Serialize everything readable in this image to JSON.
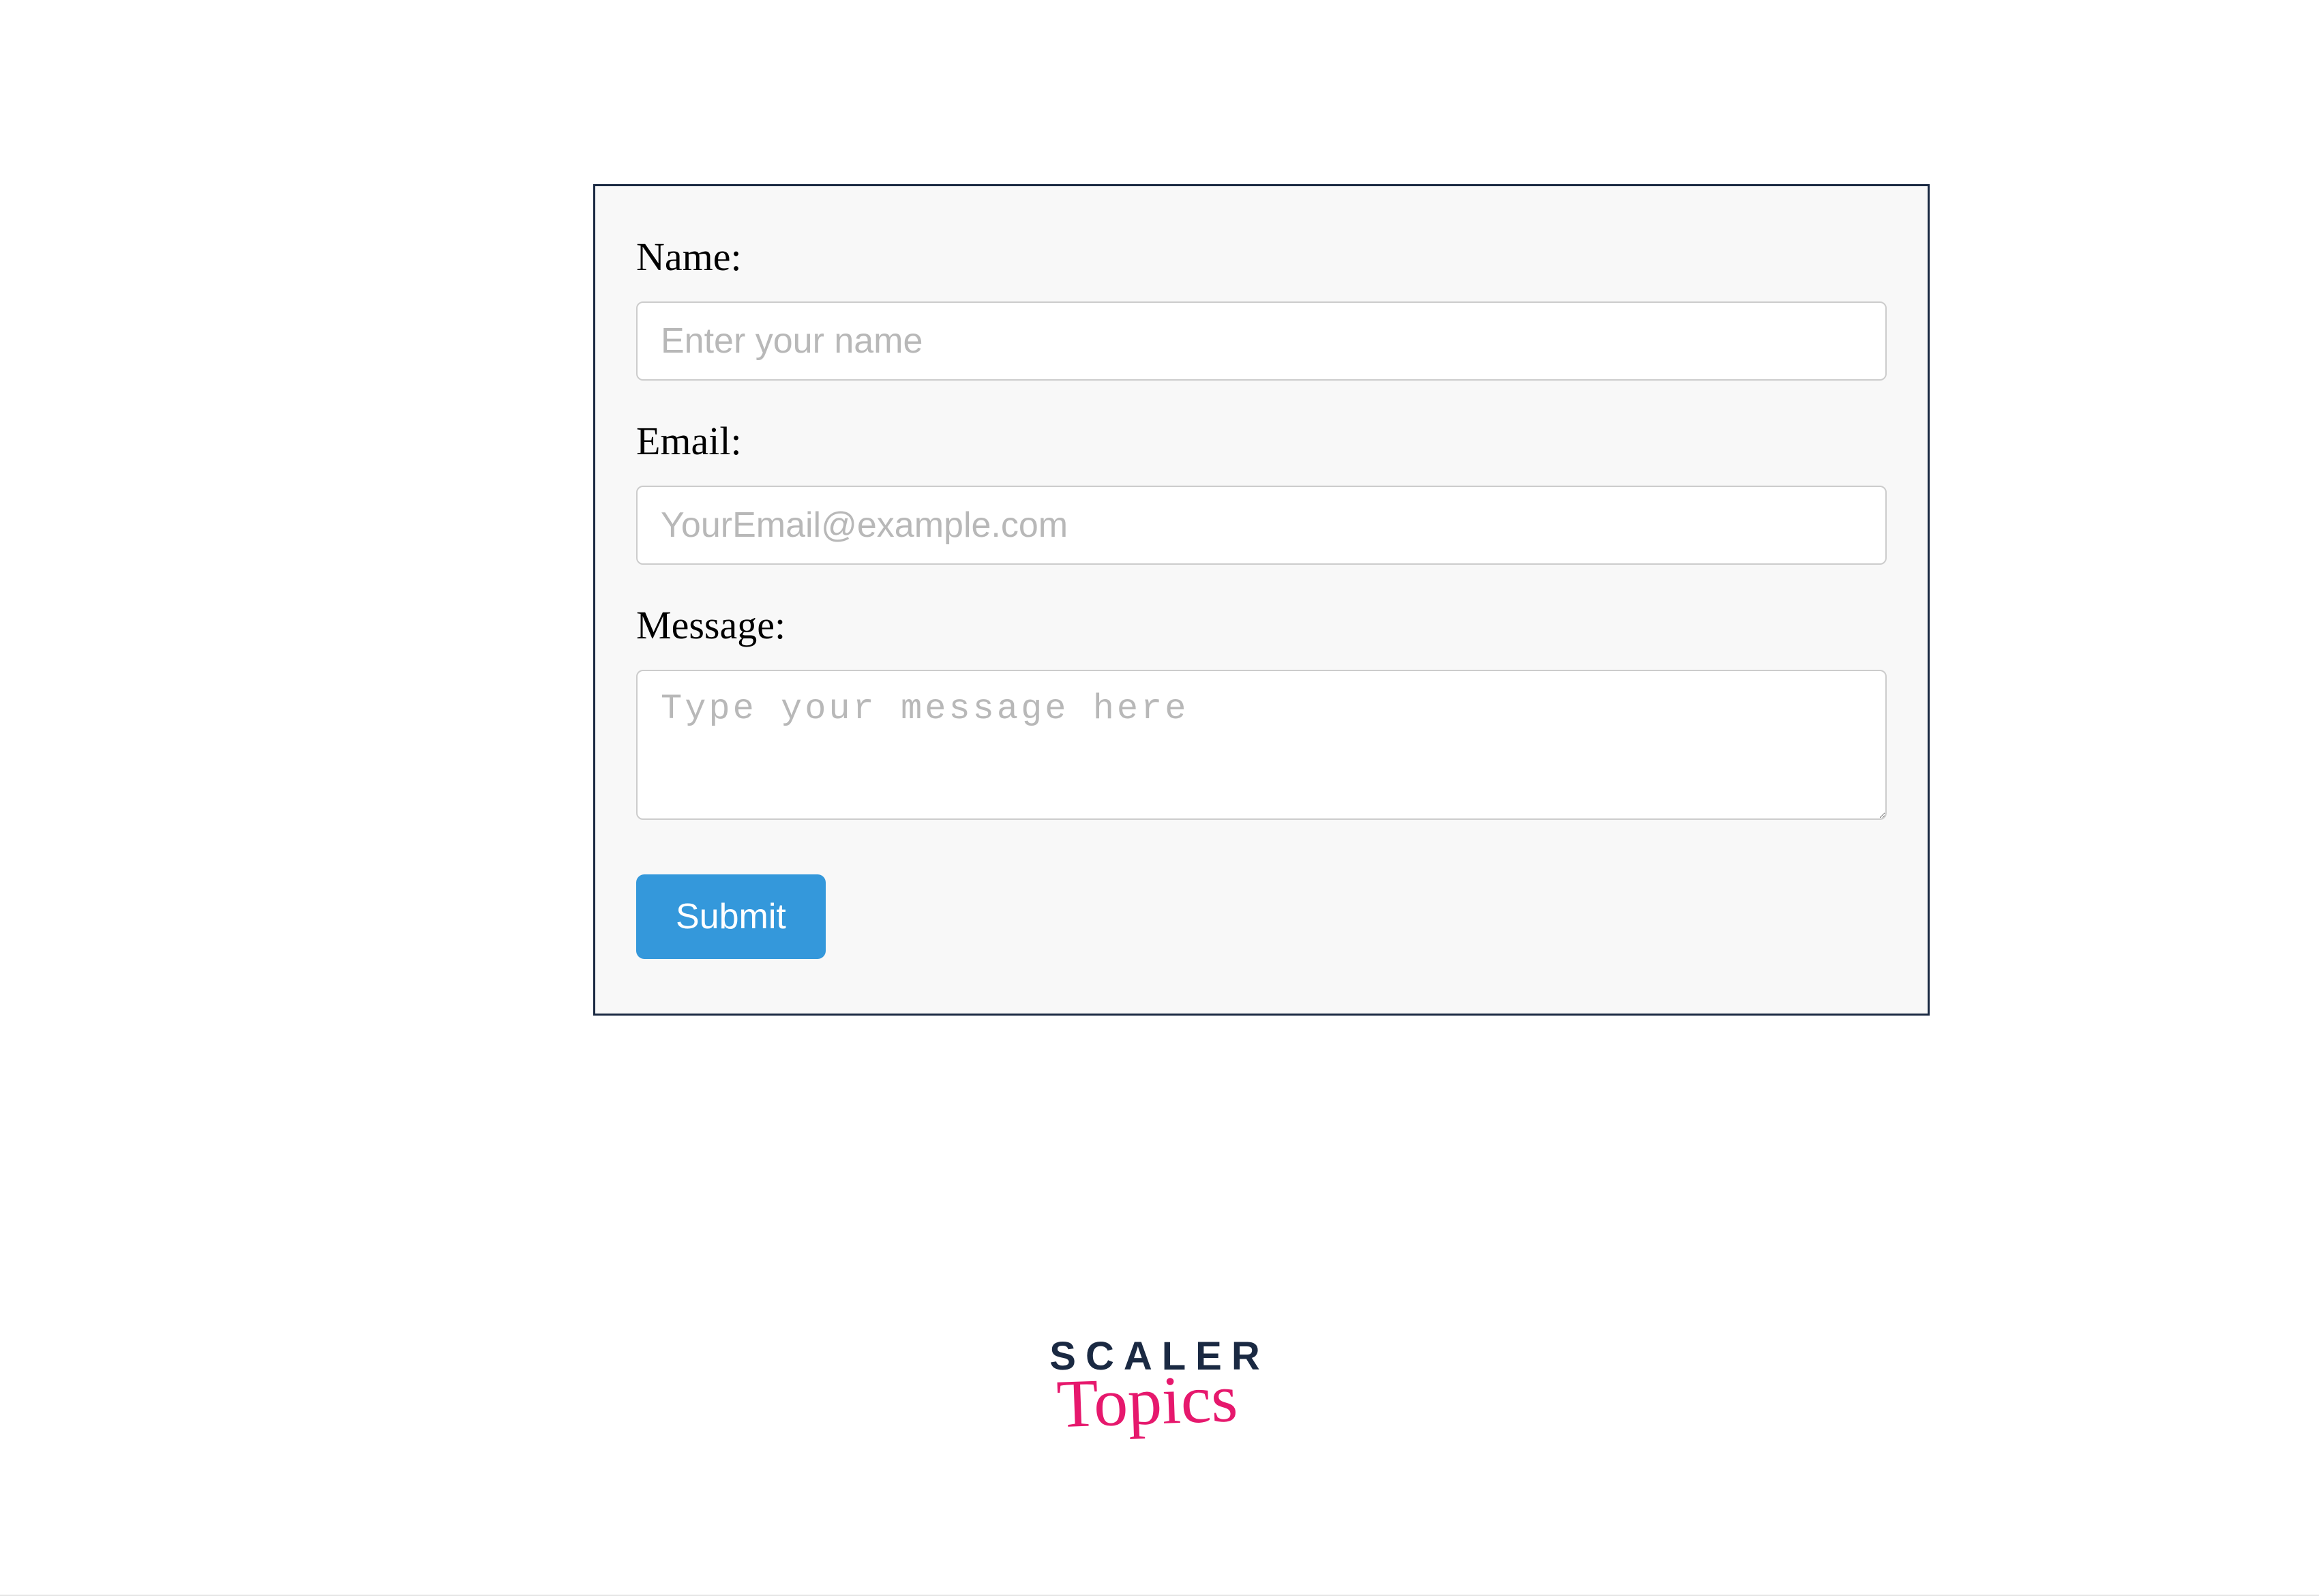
{
  "form": {
    "fields": {
      "name": {
        "label": "Name:",
        "placeholder": "Enter your name",
        "value": ""
      },
      "email": {
        "label": "Email:",
        "placeholder": "YourEmail@example.com",
        "value": ""
      },
      "message": {
        "label": "Message:",
        "placeholder": "Type your message here",
        "value": ""
      }
    },
    "submit_label": "Submit"
  },
  "logo": {
    "line1": "SCALER",
    "line2": "Topics"
  },
  "colors": {
    "panel_bg": "#f8f8f8",
    "panel_border": "#1a2942",
    "input_border": "#cccccc",
    "button_bg": "#3498db",
    "button_text": "#ffffff",
    "logo_primary": "#1a2942",
    "logo_accent": "#e6186d"
  }
}
